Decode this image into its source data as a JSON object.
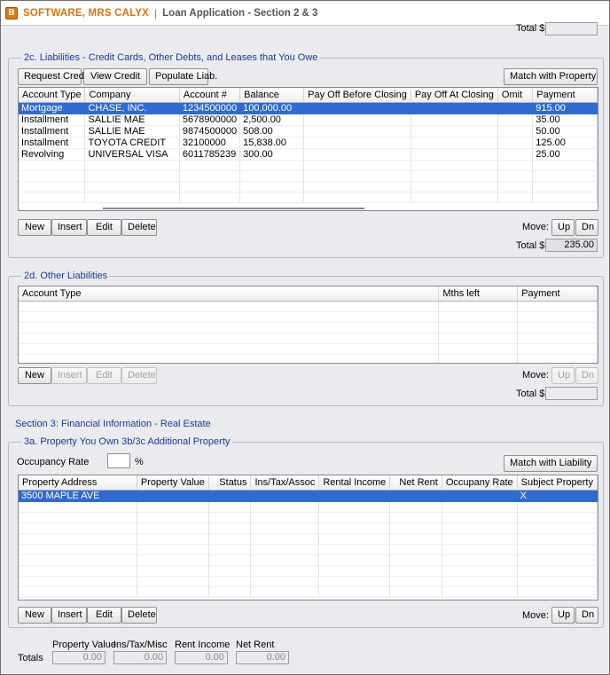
{
  "window": {
    "icon_letter": "B",
    "borrower": "SOFTWARE, MRS CALYX",
    "separator": "|",
    "screen": "Loan Application - Section 2 & 3"
  },
  "top_total": {
    "label": "Total $",
    "value": ""
  },
  "liabilities": {
    "title": "2c. Liabilities - Credit Cards, Other Debts, and Leases that You Owe",
    "request_credit": "Request Credit",
    "view_credit": "View Credit",
    "populate_liab": "Populate Liab.",
    "match_property": "Match with Property",
    "columns": [
      "Account Type",
      "Company",
      "Account #",
      "Balance",
      "Pay Off Before Closing",
      "Pay Off At Closing",
      "Omit",
      "Payment"
    ],
    "rows": [
      [
        "Mortgage",
        "CHASE, INC.",
        "1234500000",
        "100,000.00",
        "",
        "",
        "",
        "915.00"
      ],
      [
        "Installment",
        "SALLIE MAE",
        "5678900000",
        "2,500.00",
        "",
        "",
        "",
        "35.00"
      ],
      [
        "Installment",
        "SALLIE MAE",
        "9874500000",
        "508.00",
        "",
        "",
        "",
        "50.00"
      ],
      [
        "Installment",
        "TOYOTA CREDIT",
        "32100000",
        "15,838.00",
        "",
        "",
        "",
        "125.00"
      ],
      [
        "Revolving",
        "UNIVERSAL VISA",
        "6011785239",
        "300.00",
        "",
        "",
        "",
        "25.00"
      ]
    ],
    "selected_row": 0,
    "new": "New",
    "insert": "Insert",
    "edit": "Edit",
    "delete": "Delete",
    "move_label": "Move:",
    "up": "Up",
    "dn": "Dn",
    "total_label": "Total $",
    "total_value": "235.00"
  },
  "other_liabilities": {
    "title": "2d. Other Liabilities",
    "columns": [
      "Account Type",
      "Mths left",
      "Payment"
    ],
    "new": "New",
    "insert": "Insert",
    "edit": "Edit",
    "delete": "Delete",
    "move_label": "Move:",
    "up": "Up",
    "dn": "Dn",
    "total_label": "Total $",
    "total_value": ""
  },
  "section3": {
    "heading": "Section 3: Financial Information - Real Estate"
  },
  "property": {
    "title": "3a. Property You Own 3b/3c Additional Property",
    "occupancy_label": "Occupancy Rate",
    "occupancy_value": "",
    "percent": "%",
    "match_liability": "Match with Liability",
    "columns": [
      "Property Address",
      "Property Value",
      "Status",
      "Ins/Tax/Assoc",
      "Rental Income",
      "Net Rent",
      "Occupany Rate",
      "Subject Property"
    ],
    "rows": [
      [
        "3500 MAPLE AVE",
        "",
        "",
        "",
        "",
        "",
        "",
        "X"
      ]
    ],
    "selected_row": 0,
    "new": "New",
    "insert": "Insert",
    "edit": "Edit",
    "delete": "Delete",
    "move_label": "Move:",
    "up": "Up",
    "dn": "Dn"
  },
  "totals": {
    "label": "Totals",
    "property_value_label": "Property Value",
    "ins_tax_misc_label": "Ins/Tax/Misc",
    "rent_income_label": "Rent Income",
    "net_rent_label": "Net Rent",
    "property_value": "0.00",
    "ins_tax_misc": "0.00",
    "rent_income": "0.00",
    "net_rent": "0.00"
  }
}
